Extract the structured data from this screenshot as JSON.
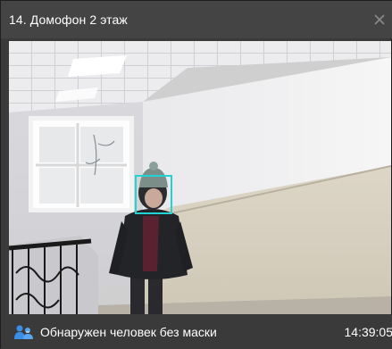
{
  "window": {
    "title": "14. Домофон 2 этаж",
    "close_icon": "close-icon"
  },
  "camera": {
    "detection_icon": "person-detection-icon"
  },
  "status": {
    "event_text": "Обнаружен человек без маски",
    "time": "14:39:05"
  },
  "colors": {
    "titlebar": "#444444",
    "background": "#3a3a3a",
    "detection_box": "#23d3d3",
    "icon_blue": "#3a8ee6"
  }
}
